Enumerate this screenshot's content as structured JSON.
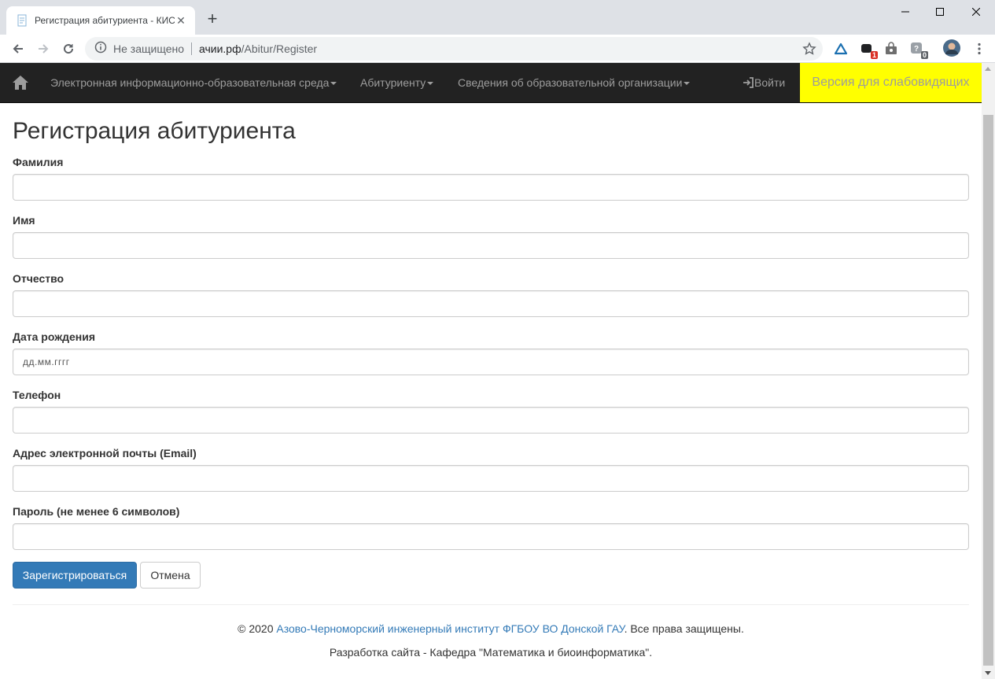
{
  "browser": {
    "tab_title": "Регистрация абитуриента - КИС",
    "security_text": "Не защищено",
    "url_host": "ачии.рф",
    "url_path": "/Abitur/Register",
    "ext_badge_1": "1",
    "ext_badge_2": "0"
  },
  "navbar": {
    "items": [
      {
        "label": "Электронная информационно-образовательная среда"
      },
      {
        "label": "Абитуриенту"
      },
      {
        "label": "Сведения об образовательной организации"
      }
    ],
    "login_label": "Войти",
    "vision_label": "Версия для слабовидящих"
  },
  "form": {
    "title": "Регистрация абитуриента",
    "fields": [
      {
        "label": "Фамилия",
        "value": "",
        "placeholder": ""
      },
      {
        "label": "Имя",
        "value": "",
        "placeholder": ""
      },
      {
        "label": "Отчество",
        "value": "",
        "placeholder": ""
      },
      {
        "label": "Дата рождения",
        "value": "",
        "placeholder": "дд.мм.гггг"
      },
      {
        "label": "Телефон",
        "value": "",
        "placeholder": ""
      },
      {
        "label": "Адрес электронной почты (Email)",
        "value": "",
        "placeholder": ""
      },
      {
        "label": "Пароль (не менее 6 символов)",
        "value": "",
        "placeholder": ""
      }
    ],
    "submit_label": "Зарегистрироваться",
    "cancel_label": "Отмена"
  },
  "footer": {
    "copyright_prefix": "© 2020 ",
    "org_link": "Азово-Черноморский инженерный институт ФГБОУ ВО Донской ГАУ",
    "copyright_suffix": ". Все права защищены.",
    "dev_line": "Разработка сайта - Кафедра \"Математика и биоинформатика\"."
  },
  "colors": {
    "navbar_bg": "#222222",
    "accent_yellow": "#ffff00",
    "primary_button": "#337ab7",
    "link": "#337ab7"
  }
}
